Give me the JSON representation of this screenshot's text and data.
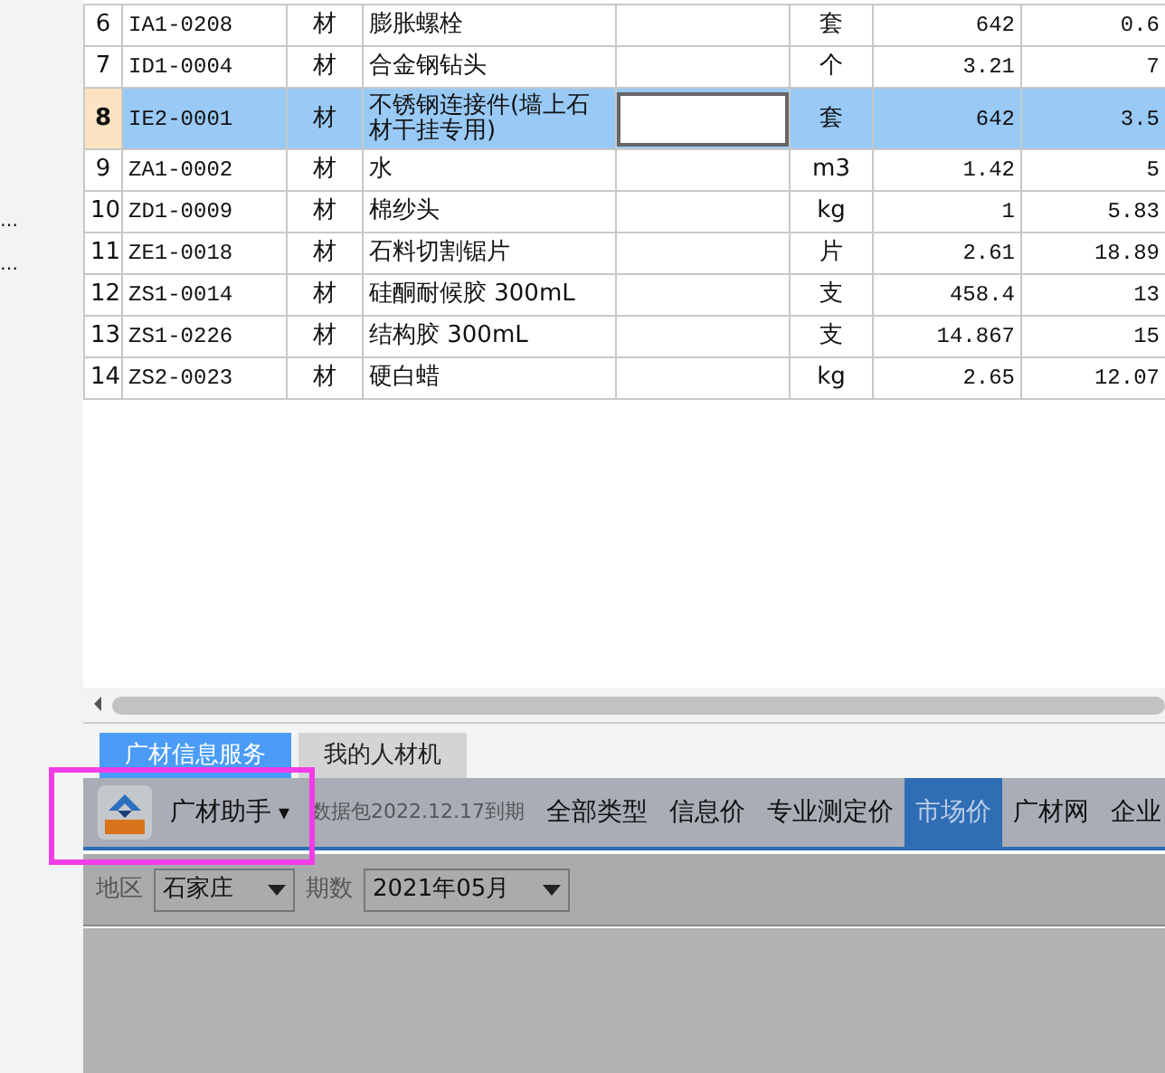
{
  "left_panel": {
    "items": [
      "…",
      "…"
    ]
  },
  "table": {
    "rows": [
      {
        "number": "6",
        "code": "IA1-0208",
        "type": "材",
        "name": "膨胀螺栓",
        "unit": "套",
        "price": "642",
        "column_8": "0.6",
        "selected": false
      },
      {
        "number": "7",
        "code": "ID1-0004",
        "type": "材",
        "name": "合金钢钻头",
        "unit": "个",
        "price": "3.21",
        "column_8": "7",
        "selected": false
      },
      {
        "number": "8",
        "code": "IE2-0001",
        "type": "材",
        "name": "不锈钢连接件(墙上石材干挂专用)",
        "unit": "套",
        "price": "642",
        "column_8": "3.5",
        "selected": true
      },
      {
        "number": "9",
        "code": "ZA1-0002",
        "type": "材",
        "name": "水",
        "unit": "m3",
        "price": "1.42",
        "column_8": "5",
        "selected": false
      },
      {
        "number": "10",
        "code": "ZD1-0009",
        "type": "材",
        "name": "棉纱头",
        "unit": "kg",
        "price": "1",
        "column_8": "5.83",
        "selected": false
      },
      {
        "number": "11",
        "code": "ZE1-0018",
        "type": "材",
        "name": "石料切割锯片",
        "unit": "片",
        "price": "2.61",
        "column_8": "18.89",
        "selected": false
      },
      {
        "number": "12",
        "code": "ZS1-0014",
        "type": "材",
        "name": "硅酮耐候胶 300mL",
        "unit": "支",
        "price": "458.4",
        "column_8": "13",
        "selected": false
      },
      {
        "number": "13",
        "code": "ZS1-0226",
        "type": "材",
        "name": "结构胶 300mL",
        "unit": "支",
        "price": "14.867",
        "column_8": "15",
        "selected": false
      },
      {
        "number": "14",
        "code": "ZS2-0023",
        "type": "材",
        "name": "硬白蜡",
        "unit": "kg",
        "price": "2.65",
        "column_8": "12.07",
        "selected": false
      }
    ]
  },
  "bottom_tabs": [
    {
      "label": "广材信息服务",
      "selected": true
    },
    {
      "label": "我的人材机",
      "selected": false
    }
  ],
  "toolbar": {
    "title": "广材助手",
    "caret": "▾",
    "package_note": "数据包2022.12.17到期",
    "nav": [
      {
        "label": "全部类型",
        "selected": false
      },
      {
        "label": "信息价",
        "selected": false
      },
      {
        "label": "专业测定价",
        "selected": false
      },
      {
        "label": "市场价",
        "selected": true
      },
      {
        "label": "广材网",
        "selected": false
      },
      {
        "label": "企业",
        "selected": false
      }
    ]
  },
  "filters": [
    {
      "label": "地区",
      "value": "石家庄"
    },
    {
      "label": "期数",
      "value": "2021年05月"
    }
  ],
  "annotation": {
    "highlight": true
  }
}
